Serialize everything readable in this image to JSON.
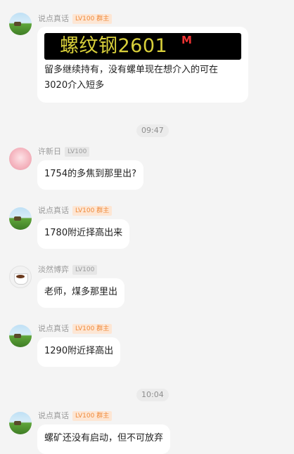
{
  "messages": [
    {
      "nickname": "说点真话",
      "level": "LV100 群主",
      "image_title": "螺纹钢2601",
      "image_mark": "M",
      "text_line1": "留多继续持有，没有螺单现在想介入的可在",
      "text_line2": "3020介入短多"
    },
    {
      "nickname": "许新日",
      "level": "LV100",
      "text": "1754的多焦到那里出?"
    },
    {
      "nickname": "说点真话",
      "level": "LV100 群主",
      "text": "1780附近择高出来"
    },
    {
      "nickname": "淡然博弈",
      "level": "LV100",
      "text": "老师，煤多那里出"
    },
    {
      "nickname": "说点真话",
      "level": "LV100 群主",
      "text": "1290附近择高出"
    },
    {
      "nickname": "说点真话",
      "level": "LV100 群主",
      "text": "螺矿还没有启动，但不可放弃"
    }
  ],
  "timestamps": [
    "09:47",
    "10:04"
  ],
  "icons": {
    "owner_avatar": "field-landscape-avatar",
    "user1_avatar": "pink-avatar",
    "user2_avatar": "coffee-cup-avatar"
  }
}
